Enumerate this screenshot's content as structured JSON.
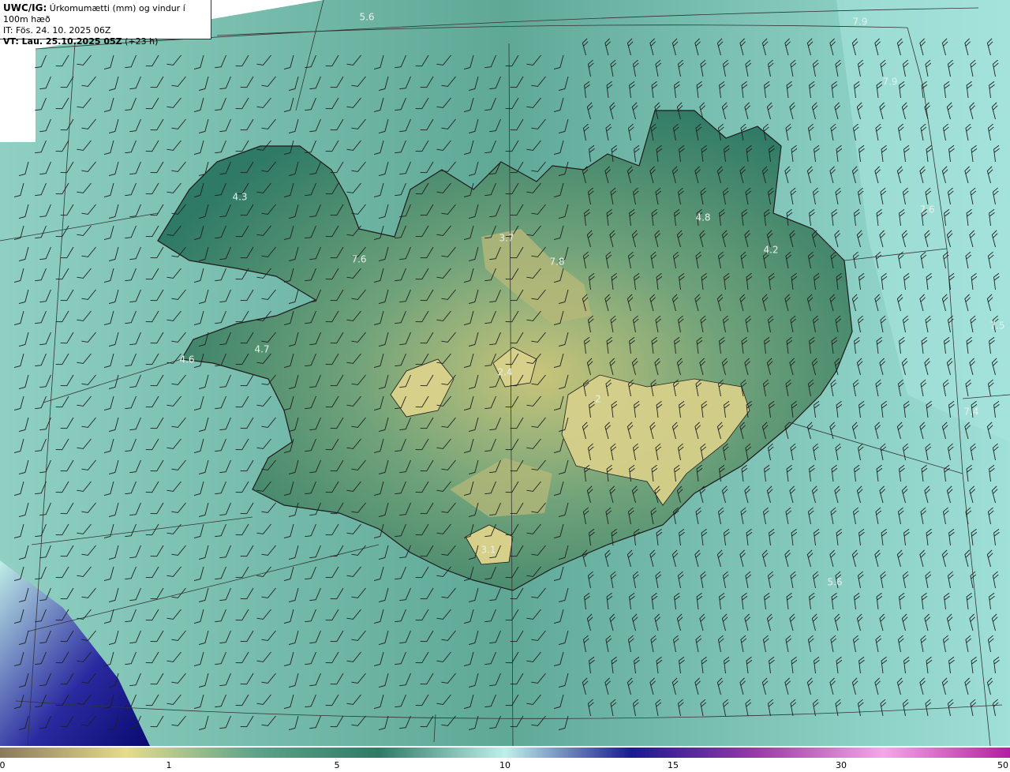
{
  "header": {
    "product": "UWC/IG:",
    "description": "Úrkomumætti (mm) og vindur í 100m hæð",
    "it_label": "IT: Fös. 24. 10. 2025 06Z",
    "vt_prefix": "VT: Lau. 25.10.2025 05Z",
    "vt_suffix": " (+23 h)"
  },
  "map_labels": [
    {
      "text": "5.6",
      "pos": [
        465,
        22
      ]
    },
    {
      "text": "7.9",
      "pos": [
        1090,
        28
      ]
    },
    {
      "text": "7.9",
      "pos": [
        1128,
        104
      ]
    },
    {
      "text": "4.3",
      "pos": [
        304,
        250
      ]
    },
    {
      "text": "4.8",
      "pos": [
        891,
        276
      ]
    },
    {
      "text": "7.6",
      "pos": [
        1175,
        266
      ]
    },
    {
      "text": "3.7",
      "pos": [
        642,
        302
      ]
    },
    {
      "text": "4.2",
      "pos": [
        977,
        317
      ]
    },
    {
      "text": "7.6",
      "pos": [
        455,
        329
      ]
    },
    {
      "text": "7.8",
      "pos": [
        706,
        332
      ]
    },
    {
      "text": "7.5",
      "pos": [
        1264,
        413
      ]
    },
    {
      "text": "4.7",
      "pos": [
        332,
        443
      ]
    },
    {
      "text": "4.6",
      "pos": [
        237,
        456
      ]
    },
    {
      "text": "2.4",
      "pos": [
        640,
        472
      ]
    },
    {
      "text": "2",
      "pos": [
        758,
        506
      ]
    },
    {
      "text": "7.4",
      "pos": [
        1231,
        522
      ]
    },
    {
      "text": "3.1",
      "pos": [
        619,
        697
      ]
    },
    {
      "text": "5.6",
      "pos": [
        1058,
        738
      ]
    }
  ],
  "colorbar": {
    "ticks": [
      {
        "label": "0",
        "pos": 3
      },
      {
        "label": "1",
        "pos": 214
      },
      {
        "label": "5",
        "pos": 427
      },
      {
        "label": "10",
        "pos": 640
      },
      {
        "label": "15",
        "pos": 853
      },
      {
        "label": "30",
        "pos": 1066
      },
      {
        "label": "50",
        "pos": 1271
      }
    ],
    "colors": [
      "#8a7a5c",
      "#e6dc8a",
      "#5fa48a",
      "#2f7a66",
      "#bff0ea",
      "#1a1a90",
      "#9a3aa8",
      "#f5a6e8",
      "#b21ea0"
    ]
  },
  "colors": {
    "sea": "#6fb8a6",
    "land_low": "#2f7a66",
    "land_high": "#c9c57a",
    "coast": "#1a1a1a",
    "grid": "#333333",
    "label": "#e8f0ec"
  }
}
